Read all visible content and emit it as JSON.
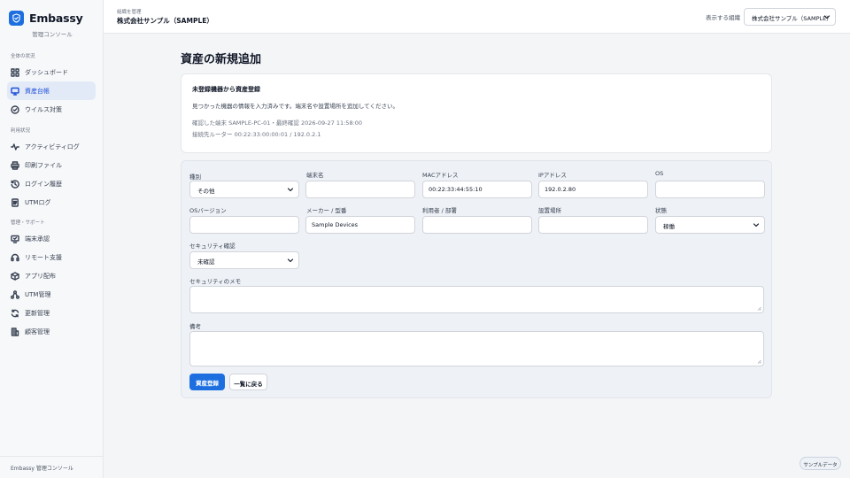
{
  "app": {
    "name": "Embassy",
    "subtitle": "管理コンソール",
    "footer": "Embassy 管理コンソール"
  },
  "sidebar": {
    "sections": [
      {
        "title": "全体の状況",
        "items": [
          {
            "label": "ダッシュボード",
            "icon": "dashboard-icon"
          },
          {
            "label": "資産台帳",
            "icon": "monitor-icon",
            "active": true
          },
          {
            "label": "ウイルス対策",
            "icon": "shield-check-icon"
          }
        ]
      },
      {
        "title": "利用状況",
        "items": [
          {
            "label": "アクティビティログ",
            "icon": "activity-icon"
          },
          {
            "label": "印刷ファイル",
            "icon": "printer-icon"
          },
          {
            "label": "ログイン履歴",
            "icon": "history-icon"
          },
          {
            "label": "UTMログ",
            "icon": "document-icon"
          }
        ]
      },
      {
        "title": "管理・サポート",
        "items": [
          {
            "label": "端末承認",
            "icon": "device-approve-icon"
          },
          {
            "label": "リモート支援",
            "icon": "headset-icon"
          },
          {
            "label": "アプリ配布",
            "icon": "package-icon"
          },
          {
            "label": "UTM管理",
            "icon": "network-icon"
          },
          {
            "label": "更新管理",
            "icon": "refresh-icon"
          },
          {
            "label": "顧客管理",
            "icon": "building-icon"
          }
        ]
      }
    ]
  },
  "header": {
    "breadcrumb_small": "組織を管理",
    "org_name": "株式会社サンプル（SAMPLE）",
    "org_select_label": "表示する組織",
    "org_select_value": "株式会社サンプル（SAMPLE）"
  },
  "page": {
    "title": "資産の新規追加"
  },
  "detected": {
    "title": "未登録機器から資産登録",
    "description": "見つかった機器の情報を入力済みです。端末名や設置場所を追加してください。",
    "meta_line1": "確認した端末 SAMPLE-PC-01・最終確認 2026-09-27 11:58:00",
    "meta_line2": "接続先ルーター 00:22:33:00:00:01 / 192.0.2.1"
  },
  "form": {
    "type": {
      "label": "種別",
      "value": "その他"
    },
    "hostname": {
      "label": "端末名",
      "value": ""
    },
    "mac": {
      "label": "MACアドレス",
      "value": "00:22:33:44:55:10"
    },
    "ip": {
      "label": "IPアドレス",
      "value": "192.0.2.80"
    },
    "os": {
      "label": "OS",
      "value": ""
    },
    "os_version": {
      "label": "OSバージョン",
      "value": ""
    },
    "maker": {
      "label": "メーカー / 型番",
      "value": "Sample Devices"
    },
    "user": {
      "label": "利用者 / 部署",
      "value": ""
    },
    "location": {
      "label": "設置場所",
      "value": ""
    },
    "status": {
      "label": "状態",
      "value": "稼働"
    },
    "security_check": {
      "label": "セキュリティ確認",
      "value": "未確認"
    },
    "security_memo": {
      "label": "セキュリティのメモ",
      "value": ""
    },
    "notes": {
      "label": "備考",
      "value": ""
    },
    "submit_label": "資産登録",
    "back_label": "一覧に戻る"
  },
  "badge": {
    "label": "サンプルデータ"
  },
  "colors": {
    "accent": "#1d6fe0",
    "active_bg": "#e3eaf7"
  }
}
